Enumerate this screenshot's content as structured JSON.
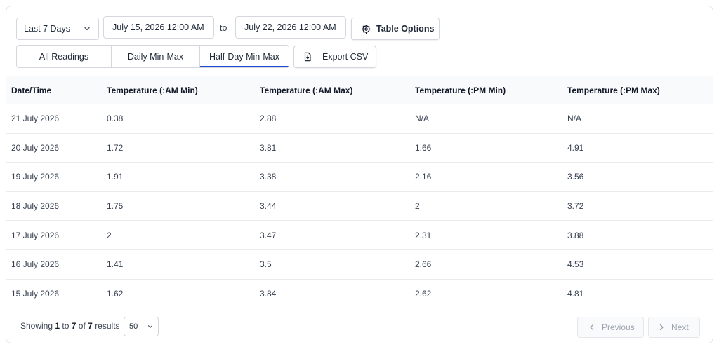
{
  "controls": {
    "range_select": "Last 7 Days",
    "date_start": "July 15, 2026 12:00 AM",
    "to_label": "to",
    "date_end": "July 22, 2026 12:00 AM",
    "table_options": "Table Options",
    "export_csv": "Export CSV"
  },
  "tabs": [
    {
      "label": "All Readings"
    },
    {
      "label": "Daily Min-Max"
    },
    {
      "label": "Half-Day Min-Max"
    }
  ],
  "active_tab": "Half-Day Min-Max",
  "accent_color": "#1d4ed8",
  "table": {
    "columns": [
      "Date/Time",
      "Temperature (:AM Min)",
      "Temperature (:AM Max)",
      "Temperature (:PM Min)",
      "Temperature (:PM Max)"
    ],
    "rows": [
      [
        "21 July 2026",
        "0.38",
        "2.88",
        "N/A",
        "N/A"
      ],
      [
        "20 July 2026",
        "1.72",
        "3.81",
        "1.66",
        "4.91"
      ],
      [
        "19 July 2026",
        "1.91",
        "3.38",
        "2.16",
        "3.56"
      ],
      [
        "18 July 2026",
        "1.75",
        "3.44",
        "2",
        "3.72"
      ],
      [
        "17 July 2026",
        "2",
        "3.47",
        "2.31",
        "3.88"
      ],
      [
        "16 July 2026",
        "1.41",
        "3.5",
        "2.66",
        "4.53"
      ],
      [
        "15 July 2026",
        "1.62",
        "3.84",
        "2.62",
        "4.81"
      ]
    ]
  },
  "footer": {
    "showing_prefix": "Showing",
    "from": "1",
    "to_word": "to",
    "to": "7",
    "of_word": "of",
    "total": "7",
    "results_word": "results",
    "per_page": "50",
    "previous": "Previous",
    "next": "Next"
  }
}
